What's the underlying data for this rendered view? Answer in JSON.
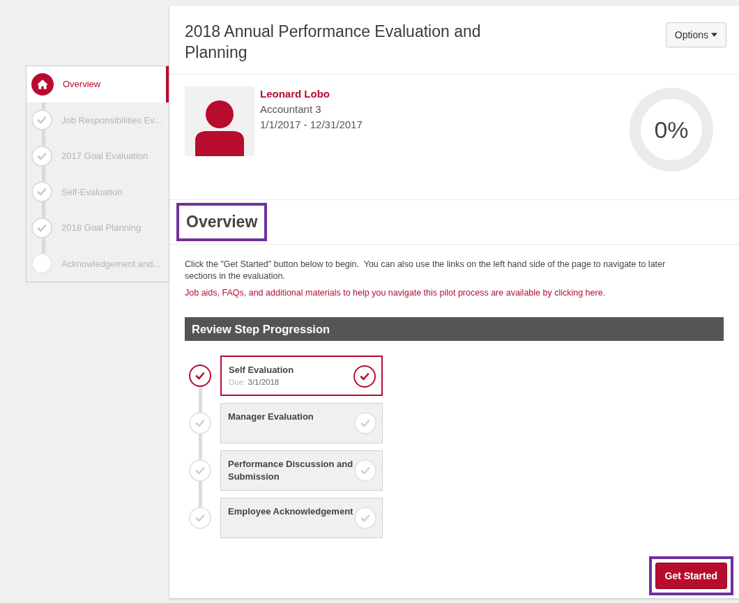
{
  "sidebar": {
    "items": [
      {
        "label": "Overview",
        "kind": "home",
        "selected": true
      },
      {
        "label": "Job Responsibilities Ev...",
        "kind": "step",
        "selected": false,
        "completed": true
      },
      {
        "label": "2017 Goal Evaluation",
        "kind": "step",
        "selected": false,
        "completed": true
      },
      {
        "label": "Self-Evaluation",
        "kind": "step",
        "selected": false,
        "completed": true
      },
      {
        "label": "2018 Goal Planning",
        "kind": "step",
        "selected": false,
        "completed": true
      },
      {
        "label": "Acknowledgement and...",
        "kind": "step",
        "selected": false,
        "completed": false
      }
    ]
  },
  "header": {
    "title": "2018 Annual Performance Evaluation and Planning",
    "options_button": "Options"
  },
  "profile": {
    "name": "Leonard Lobo",
    "role": "Accountant 3",
    "period": "1/1/2017 - 12/31/2017",
    "progress": "0%",
    "level": 0
  },
  "overview": {
    "heading": "Overview",
    "highlighted": true,
    "intro": "Click the \"Get Started\" button below to begin.  You can also use the links on the left hand side of the page to navigate to later sections in the evaluation.",
    "link": "Job aids, FAQs, and additional materials to help you navigate this pilot process are available by clicking here."
  },
  "review": {
    "title": "Review Step Progression",
    "steps": [
      {
        "title": "Self Evaluation",
        "due_label": "Due:",
        "due": "3/1/2018",
        "selected": true
      },
      {
        "title": "Manager Evaluation",
        "selected": false
      },
      {
        "title": "Performance Discussion and Submission",
        "selected": false
      },
      {
        "title": "Employee Acknowledgement",
        "selected": false
      }
    ]
  },
  "get_started": {
    "label": "Get Started",
    "highlighted": true
  }
}
